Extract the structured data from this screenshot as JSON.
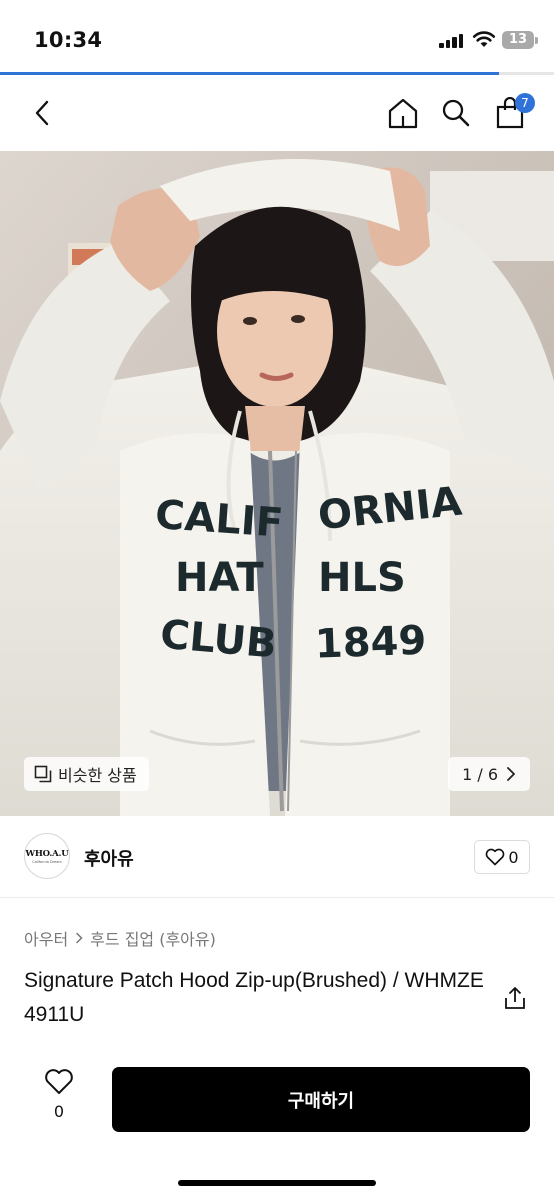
{
  "status_bar": {
    "time": "10:34",
    "battery": "13"
  },
  "loading": {
    "progress": 0.9
  },
  "nav": {
    "back_icon": "chevron-left-icon",
    "home_icon": "home-icon",
    "search_icon": "search-icon",
    "cart_icon": "shopping-bag-icon",
    "cart_count": "7"
  },
  "hero": {
    "hoodie_text": {
      "row1_left": "CALIF",
      "row1_right": "ORNIA",
      "row2_left": "HAT",
      "row2_right": "HLS",
      "row3_left": "CLUB",
      "row3_right": "1849"
    },
    "similar_label": "비슷한 상품",
    "page_indicator": "1 / 6"
  },
  "brand": {
    "logo_text": "WHO.A.U",
    "logo_sub": "California Dream",
    "name": "후아유",
    "like_count": "0"
  },
  "breadcrumb": [
    "아우터",
    "후드 집업 (후아유)"
  ],
  "product": {
    "title": "Signature Patch Hood Zip-up(Brushed) / WHMZE4911U"
  },
  "bottom": {
    "wish_count": "0",
    "buy_label": "구매하기"
  },
  "colors": {
    "accent": "#2f73d8",
    "buy_button": "#000000",
    "badge": "#2f73d8"
  }
}
